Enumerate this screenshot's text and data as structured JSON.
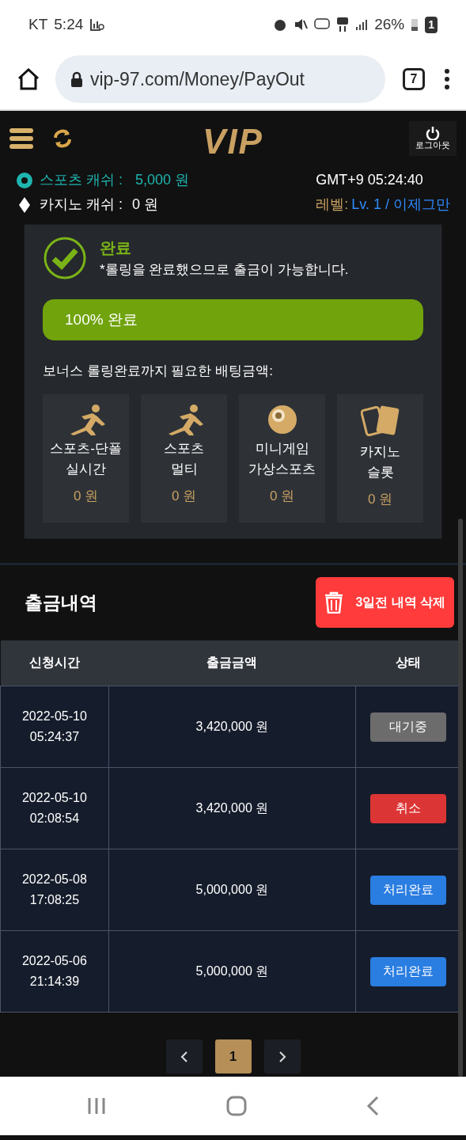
{
  "status_bar": {
    "carrier": "KT",
    "time": "5:24",
    "battery": "26%",
    "notification_count": "1"
  },
  "browser": {
    "url": "vip-97.com/Money/PayOut",
    "tab_count": "7"
  },
  "header": {
    "logo": "VIP",
    "logout": "로그아웃"
  },
  "account": {
    "sports_cash_label": "스포츠 캐쉬 :",
    "sports_cash": "5,000 원",
    "casino_cash_label": "카지노 캐쉬 :",
    "casino_cash": "0 원",
    "clock": "GMT+9 05:24:40",
    "level_label": "레벨:",
    "level_value": "Lv. 1 / 이제그만"
  },
  "rolling": {
    "title": "완료",
    "message": "*롤링을 완료했으므로 출금이 가능합니다.",
    "progress": {
      "label": "100% 완료",
      "level": 1
    },
    "required_label": "보너스 롤링완료까지 필요한 배팅금액:",
    "categories": [
      {
        "kind": "runner",
        "lines": [
          "스포츠-단폴",
          "실시간"
        ],
        "amount": "0 원"
      },
      {
        "kind": "runner",
        "lines": [
          "스포츠",
          "멀티"
        ],
        "amount": "0 원"
      },
      {
        "kind": "ball",
        "lines": [
          "미니게임",
          "가상스포츠"
        ],
        "amount": "0 원"
      },
      {
        "kind": "cards",
        "lines": [
          "카지노",
          "슬롯"
        ],
        "amount": "0 원"
      }
    ]
  },
  "history": {
    "title": "출금내역",
    "delete_button": "3일전 내역 삭제",
    "columns": [
      "신청시간",
      "출금금액",
      "상태"
    ],
    "rows": [
      {
        "date": "2022-05-10",
        "time": "05:24:37",
        "amount": "3,420,000 원",
        "status": "대기중",
        "kind": "pending"
      },
      {
        "date": "2022-05-10",
        "time": "02:08:54",
        "amount": "3,420,000 원",
        "status": "취소",
        "kind": "cancelled"
      },
      {
        "date": "2022-05-08",
        "time": "17:08:25",
        "amount": "5,000,000 원",
        "status": "처리완료",
        "kind": "done"
      },
      {
        "date": "2022-05-06",
        "time": "21:14:39",
        "amount": "5,000,000 원",
        "status": "처리완료",
        "kind": "done"
      }
    ]
  },
  "pagination": {
    "pages": [
      {
        "label": "1",
        "selected": true
      }
    ]
  }
}
